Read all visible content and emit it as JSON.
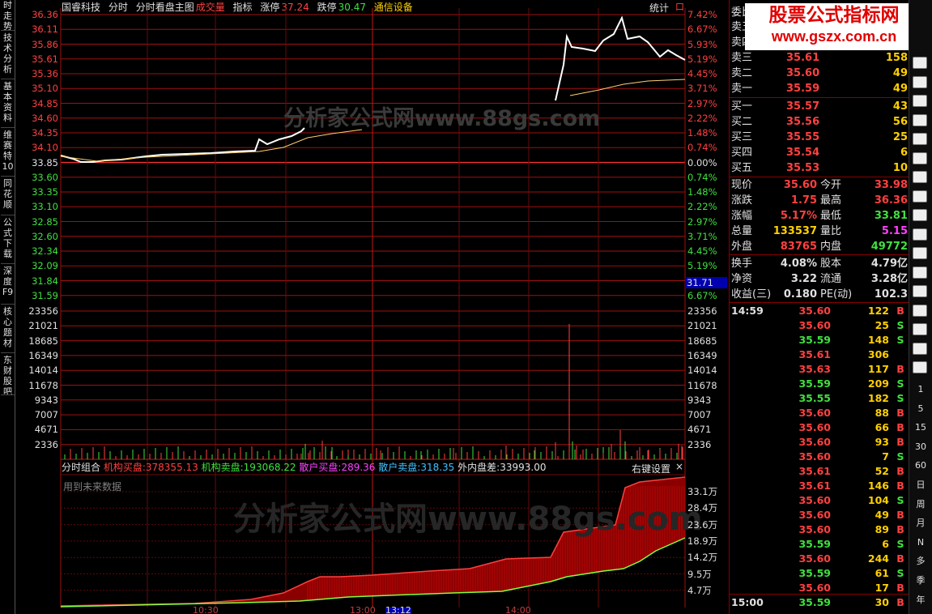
{
  "sidebar": {
    "tabs": [
      "时走势",
      "技术分析",
      "基本资料",
      "维赛特10",
      "同花顺",
      "公式下载",
      "深度F9",
      "核心题材",
      "东财股吧"
    ]
  },
  "header": {
    "stock_name": "国睿科技",
    "chart_name": "分时",
    "main_name": "分时看盘主图",
    "vol_indicator": "成交量",
    "indicator": "指标",
    "limit_up_label": "涨停",
    "limit_up_value": "37.24",
    "limit_down_label": "跌停",
    "limit_down_value": "30.47",
    "sector": "通信设备",
    "stats": "统计",
    "close_btn": "口"
  },
  "price_axis": {
    "left": [
      {
        "t": "36.36",
        "c": "#ff4040"
      },
      {
        "t": "36.11",
        "c": "#ff4040"
      },
      {
        "t": "35.86",
        "c": "#ff4040"
      },
      {
        "t": "35.61",
        "c": "#ff4040"
      },
      {
        "t": "35.36",
        "c": "#ff4040"
      },
      {
        "t": "35.10",
        "c": "#ff4040"
      },
      {
        "t": "34.85",
        "c": "#ff4040"
      },
      {
        "t": "34.60",
        "c": "#ff4040"
      },
      {
        "t": "34.35",
        "c": "#ff4040"
      },
      {
        "t": "34.10",
        "c": "#ff4040"
      },
      {
        "t": "33.85",
        "c": "#e0e0e0"
      },
      {
        "t": "33.60",
        "c": "#40e040"
      },
      {
        "t": "33.35",
        "c": "#40e040"
      },
      {
        "t": "33.10",
        "c": "#40e040"
      },
      {
        "t": "32.85",
        "c": "#40e040"
      },
      {
        "t": "32.60",
        "c": "#40e040"
      },
      {
        "t": "32.34",
        "c": "#40e040"
      },
      {
        "t": "32.09",
        "c": "#40e040"
      },
      {
        "t": "31.84",
        "c": "#40e040"
      },
      {
        "t": "31.59",
        "c": "#40e040"
      }
    ],
    "right": [
      {
        "t": "7.42%",
        "c": "#ff4040"
      },
      {
        "t": "6.67%",
        "c": "#ff4040"
      },
      {
        "t": "5.93%",
        "c": "#ff4040"
      },
      {
        "t": "5.19%",
        "c": "#ff4040"
      },
      {
        "t": "4.45%",
        "c": "#ff4040"
      },
      {
        "t": "3.71%",
        "c": "#ff4040"
      },
      {
        "t": "2.97%",
        "c": "#ff4040"
      },
      {
        "t": "2.22%",
        "c": "#ff4040"
      },
      {
        "t": "1.48%",
        "c": "#ff4040"
      },
      {
        "t": "0.74%",
        "c": "#ff4040"
      },
      {
        "t": "0.00%",
        "c": "#e0e0e0"
      },
      {
        "t": "0.74%",
        "c": "#40e040"
      },
      {
        "t": "1.48%",
        "c": "#40e040"
      },
      {
        "t": "2.22%",
        "c": "#40e040"
      },
      {
        "t": "2.97%",
        "c": "#40e040"
      },
      {
        "t": "3.71%",
        "c": "#40e040"
      },
      {
        "t": "4.45%",
        "c": "#40e040"
      },
      {
        "t": "5.19%",
        "c": "#40e040"
      },
      {
        "t": "",
        "c": "#40e040"
      },
      {
        "t": "6.67%",
        "c": "#40e040"
      }
    ],
    "cursor_value": "31.71"
  },
  "volume_axis": {
    "labels": [
      "23356",
      "21021",
      "18685",
      "16349",
      "14014",
      "11678",
      "9343",
      "7007",
      "4671",
      "2336"
    ]
  },
  "sub_chart": {
    "title": "分时组合",
    "inst_buy_label": "机构买盘:",
    "inst_buy_value": "378355.13",
    "inst_sell_label": "机构卖盘:",
    "inst_sell_value": "193068.22",
    "retail_buy_label": "散户买盘:",
    "retail_buy_value": "289.36",
    "retail_sell_label": "散户卖盘:",
    "retail_sell_value": "318.35",
    "diff_label": "外内盘差:",
    "diff_value": "33993.00",
    "settings": "右键设置",
    "close": "×",
    "future_note": "用到未来数据",
    "axis": [
      "33.1万",
      "28.4万",
      "23.6万",
      "18.9万",
      "14.2万",
      "9.5万",
      "4.7万"
    ]
  },
  "time_axis": {
    "labels": [
      "10:30",
      "13:00",
      "13:12",
      "14:00"
    ]
  },
  "watermark": {
    "main": "分析家公式网www.88gs.com",
    "sub": "分析家公式网www.88gs.com"
  },
  "banner": {
    "line1": "股票公式指标网",
    "line2": "www.gszx.com.cn"
  },
  "order_book": {
    "header": "委比",
    "sells": [
      {
        "k": "卖五",
        "p": "",
        "v": ""
      },
      {
        "k": "卖四",
        "p": "",
        "v": ""
      },
      {
        "k": "卖三",
        "p": "35.61",
        "v": "158"
      },
      {
        "k": "卖二",
        "p": "35.60",
        "v": "49"
      },
      {
        "k": "卖一",
        "p": "35.59",
        "v": "49"
      }
    ],
    "buys": [
      {
        "k": "买一",
        "p": "35.57",
        "v": "43"
      },
      {
        "k": "买二",
        "p": "35.56",
        "v": "56"
      },
      {
        "k": "买三",
        "p": "35.55",
        "v": "25"
      },
      {
        "k": "买四",
        "p": "35.54",
        "v": "6"
      },
      {
        "k": "买五",
        "p": "35.53",
        "v": "10"
      }
    ]
  },
  "quote": [
    {
      "k1": "现价",
      "v1": "35.60",
      "c1": "#ff4040",
      "k2": "今开",
      "v2": "33.98",
      "c2": "#ff4040"
    },
    {
      "k1": "涨跌",
      "v1": "1.75",
      "c1": "#ff4040",
      "k2": "最高",
      "v2": "36.36",
      "c2": "#ff4040"
    },
    {
      "k1": "涨幅",
      "v1": "5.17%",
      "c1": "#ff4040",
      "k2": "最低",
      "v2": "33.81",
      "c2": "#40e040"
    },
    {
      "k1": "总量",
      "v1": "133537",
      "c1": "#ffd000",
      "k2": "量比",
      "v2": "5.15",
      "c2": "#ff40ff"
    },
    {
      "k1": "外盘",
      "v1": "83765",
      "c1": "#ff4040",
      "k2": "内盘",
      "v2": "49772",
      "c2": "#40e040"
    }
  ],
  "quote2": [
    {
      "k1": "换手",
      "v1": "4.08%",
      "k2": "股本",
      "v2": "4.79亿"
    },
    {
      "k1": "净资",
      "v1": "3.22",
      "k2": "流通",
      "v2": "3.28亿"
    },
    {
      "k1": "收益(三)",
      "v1": "0.180",
      "k2": "PE(动)",
      "v2": "102.3"
    }
  ],
  "ticks": [
    {
      "t": "14:59",
      "p": "35.60",
      "v": "122",
      "d": "B"
    },
    {
      "t": "",
      "p": "35.60",
      "v": "25",
      "d": "S"
    },
    {
      "t": "",
      "p": "35.59",
      "v": "148",
      "d": "S"
    },
    {
      "t": "",
      "p": "35.61",
      "v": "306",
      "d": ""
    },
    {
      "t": "",
      "p": "35.63",
      "v": "117",
      "d": "B"
    },
    {
      "t": "",
      "p": "35.59",
      "v": "209",
      "d": "S"
    },
    {
      "t": "",
      "p": "35.55",
      "v": "182",
      "d": "S"
    },
    {
      "t": "",
      "p": "35.60",
      "v": "88",
      "d": "B"
    },
    {
      "t": "",
      "p": "35.60",
      "v": "66",
      "d": "B"
    },
    {
      "t": "",
      "p": "35.60",
      "v": "93",
      "d": "B"
    },
    {
      "t": "",
      "p": "35.60",
      "v": "7",
      "d": "S"
    },
    {
      "t": "",
      "p": "35.61",
      "v": "52",
      "d": "B"
    },
    {
      "t": "",
      "p": "35.61",
      "v": "146",
      "d": "B"
    },
    {
      "t": "",
      "p": "35.60",
      "v": "104",
      "d": "S"
    },
    {
      "t": "",
      "p": "35.60",
      "v": "49",
      "d": "B"
    },
    {
      "t": "",
      "p": "35.60",
      "v": "89",
      "d": "B"
    },
    {
      "t": "",
      "p": "35.59",
      "v": "6",
      "d": "S"
    },
    {
      "t": "",
      "p": "35.60",
      "v": "244",
      "d": "B"
    },
    {
      "t": "",
      "p": "35.59",
      "v": "61",
      "d": "S"
    },
    {
      "t": "",
      "p": "35.60",
      "v": "17",
      "d": "B"
    },
    {
      "t": "15:00",
      "p": "35.59",
      "v": "30",
      "d": "B"
    }
  ],
  "toolbar": {
    "icons": [
      "table-icon",
      "line-chart-icon",
      "kline-icon",
      "f10-icon",
      "info-icon",
      "sheet-icon",
      "f1-icon",
      "f2-icon",
      "f6-icon",
      "refresh-icon",
      "wave-icon",
      "chart2-icon",
      "chart3-icon",
      "percent-icon",
      "pen-icon",
      "f5-icon",
      "reload-icon"
    ],
    "labels": [
      "1",
      "5",
      "15",
      "30",
      "60",
      "日",
      "周",
      "月",
      "N",
      "多",
      "季",
      "年"
    ]
  }
}
